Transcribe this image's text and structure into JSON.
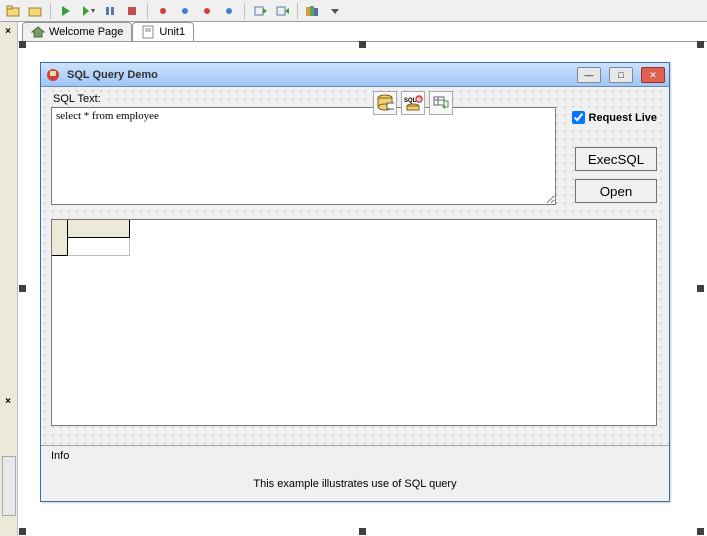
{
  "tabs": {
    "welcome": "Welcome Page",
    "unit1": "Unit1"
  },
  "form": {
    "title": "SQL Query Demo",
    "sql_label": "SQL Text:",
    "sql_value": "select * from employee",
    "request_live": "Request Live",
    "exec_sql": "ExecSQL",
    "open": "Open",
    "info_label": "Info",
    "info_text": "This example illustrates use of SQL query"
  }
}
